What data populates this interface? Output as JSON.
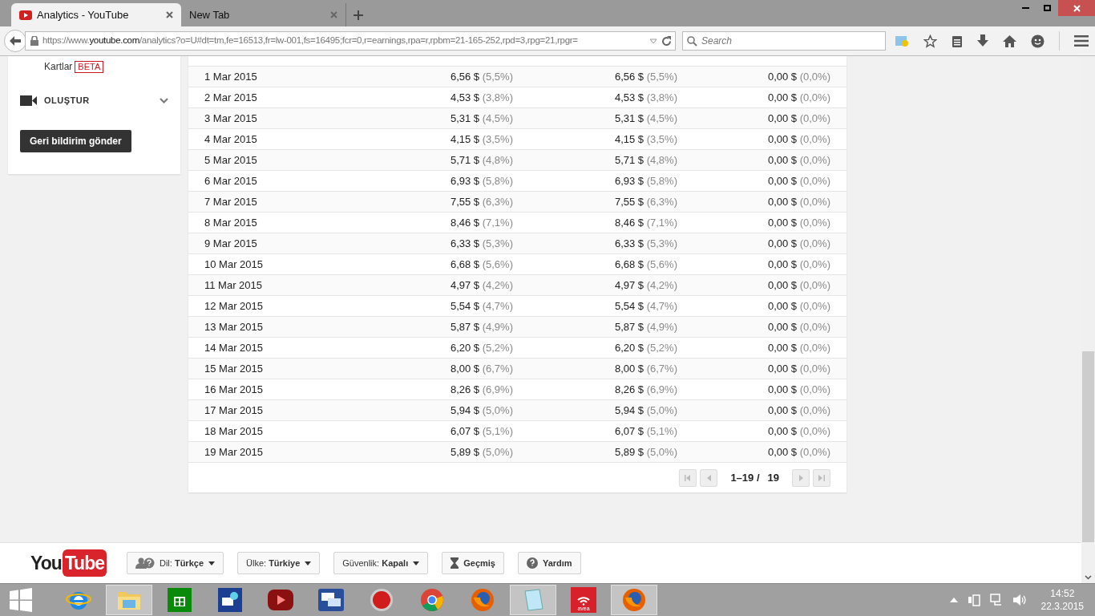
{
  "browser": {
    "tabs": [
      {
        "title": "Analytics - YouTube",
        "selected": true
      },
      {
        "title": "New Tab",
        "selected": false
      }
    ],
    "url_plain_start": "https://www.",
    "url_domain": "youtube.com",
    "url_rest": "/analytics?o=U#dt=tm,fe=16513,fr=lw-001,fs=16495;fcr=0,r=earnings,rpa=r,rpbm=21-165-252,rpd=3,rpg=21,rpgr=",
    "search": {
      "placeholder": "Search"
    }
  },
  "sidebar": {
    "item": "Kartlar",
    "badge": "BETA",
    "section": "OLUŞTUR",
    "section_expanded": false,
    "feedback_button": "Geri bildirim gönder"
  },
  "table": {
    "rows": [
      {
        "date": "1 Mar 2015",
        "c2": "6,56 $",
        "c2p": "(5,5%)",
        "c3": "6,56 $",
        "c3p": "(5,5%)",
        "c4": "0,00 $",
        "c4p": "(0,0%)"
      },
      {
        "date": "2 Mar 2015",
        "c2": "4,53 $",
        "c2p": "(3,8%)",
        "c3": "4,53 $",
        "c3p": "(3,8%)",
        "c4": "0,00 $",
        "c4p": "(0,0%)"
      },
      {
        "date": "3 Mar 2015",
        "c2": "5,31 $",
        "c2p": "(4,5%)",
        "c3": "5,31 $",
        "c3p": "(4,5%)",
        "c4": "0,00 $",
        "c4p": "(0,0%)"
      },
      {
        "date": "4 Mar 2015",
        "c2": "4,15 $",
        "c2p": "(3,5%)",
        "c3": "4,15 $",
        "c3p": "(3,5%)",
        "c4": "0,00 $",
        "c4p": "(0,0%)"
      },
      {
        "date": "5 Mar 2015",
        "c2": "5,71 $",
        "c2p": "(4,8%)",
        "c3": "5,71 $",
        "c3p": "(4,8%)",
        "c4": "0,00 $",
        "c4p": "(0,0%)"
      },
      {
        "date": "6 Mar 2015",
        "c2": "6,93 $",
        "c2p": "(5,8%)",
        "c3": "6,93 $",
        "c3p": "(5,8%)",
        "c4": "0,00 $",
        "c4p": "(0,0%)"
      },
      {
        "date": "7 Mar 2015",
        "c2": "7,55 $",
        "c2p": "(6,3%)",
        "c3": "7,55 $",
        "c3p": "(6,3%)",
        "c4": "0,00 $",
        "c4p": "(0,0%)"
      },
      {
        "date": "8 Mar 2015",
        "c2": "8,46 $",
        "c2p": "(7,1%)",
        "c3": "8,46 $",
        "c3p": "(7,1%)",
        "c4": "0,00 $",
        "c4p": "(0,0%)"
      },
      {
        "date": "9 Mar 2015",
        "c2": "6,33 $",
        "c2p": "(5,3%)",
        "c3": "6,33 $",
        "c3p": "(5,3%)",
        "c4": "0,00 $",
        "c4p": "(0,0%)"
      },
      {
        "date": "10 Mar 2015",
        "c2": "6,68 $",
        "c2p": "(5,6%)",
        "c3": "6,68 $",
        "c3p": "(5,6%)",
        "c4": "0,00 $",
        "c4p": "(0,0%)"
      },
      {
        "date": "11 Mar 2015",
        "c2": "4,97 $",
        "c2p": "(4,2%)",
        "c3": "4,97 $",
        "c3p": "(4,2%)",
        "c4": "0,00 $",
        "c4p": "(0,0%)"
      },
      {
        "date": "12 Mar 2015",
        "c2": "5,54 $",
        "c2p": "(4,7%)",
        "c3": "5,54 $",
        "c3p": "(4,7%)",
        "c4": "0,00 $",
        "c4p": "(0,0%)"
      },
      {
        "date": "13 Mar 2015",
        "c2": "5,87 $",
        "c2p": "(4,9%)",
        "c3": "5,87 $",
        "c3p": "(4,9%)",
        "c4": "0,00 $",
        "c4p": "(0,0%)"
      },
      {
        "date": "14 Mar 2015",
        "c2": "6,20 $",
        "c2p": "(5,2%)",
        "c3": "6,20 $",
        "c3p": "(5,2%)",
        "c4": "0,00 $",
        "c4p": "(0,0%)"
      },
      {
        "date": "15 Mar 2015",
        "c2": "8,00 $",
        "c2p": "(6,7%)",
        "c3": "8,00 $",
        "c3p": "(6,7%)",
        "c4": "0,00 $",
        "c4p": "(0,0%)"
      },
      {
        "date": "16 Mar 2015",
        "c2": "8,26 $",
        "c2p": "(6,9%)",
        "c3": "8,26 $",
        "c3p": "(6,9%)",
        "c4": "0,00 $",
        "c4p": "(0,0%)"
      },
      {
        "date": "17 Mar 2015",
        "c2": "5,94 $",
        "c2p": "(5,0%)",
        "c3": "5,94 $",
        "c3p": "(5,0%)",
        "c4": "0,00 $",
        "c4p": "(0,0%)"
      },
      {
        "date": "18 Mar 2015",
        "c2": "6,07 $",
        "c2p": "(5,1%)",
        "c3": "6,07 $",
        "c3p": "(5,1%)",
        "c4": "0,00 $",
        "c4p": "(0,0%)"
      },
      {
        "date": "19 Mar 2015",
        "c2": "5,89 $",
        "c2p": "(5,0%)",
        "c3": "5,89 $",
        "c3p": "(5,0%)",
        "c4": "0,00 $",
        "c4p": "(0,0%)"
      }
    ],
    "pager": {
      "range": "1–19 /",
      "total": "19"
    }
  },
  "footer": {
    "logo_you": "You",
    "logo_tube": "Tube",
    "buttons": [
      {
        "kind": "language",
        "label": "Dil:",
        "value": "Türkçe"
      },
      {
        "kind": "country",
        "label": "Ülke:",
        "value": "Türkiye"
      },
      {
        "kind": "safety",
        "label": "Güvenlik:",
        "value": "Kapalı"
      },
      {
        "kind": "history",
        "value": "Geçmiş"
      },
      {
        "kind": "help",
        "value": "Yardım"
      }
    ]
  },
  "taskbar": {
    "apps": [
      {
        "kind": "ie",
        "highlighted": false
      },
      {
        "kind": "folder",
        "highlighted": true
      },
      {
        "kind": "store",
        "highlighted": false
      },
      {
        "kind": "network",
        "highlighted": false
      },
      {
        "kind": "player",
        "highlighted": false
      },
      {
        "kind": "chat",
        "highlighted": false
      },
      {
        "kind": "nero",
        "highlighted": false
      },
      {
        "kind": "chrome",
        "highlighted": false
      },
      {
        "kind": "firefox",
        "highlighted": false
      },
      {
        "kind": "notepad",
        "highlighted": true
      },
      {
        "kind": "avea",
        "highlighted": false
      },
      {
        "kind": "firefox",
        "highlighted": true
      }
    ],
    "avea_label": "avea",
    "time": "14:52",
    "date": "22.3.2015"
  }
}
